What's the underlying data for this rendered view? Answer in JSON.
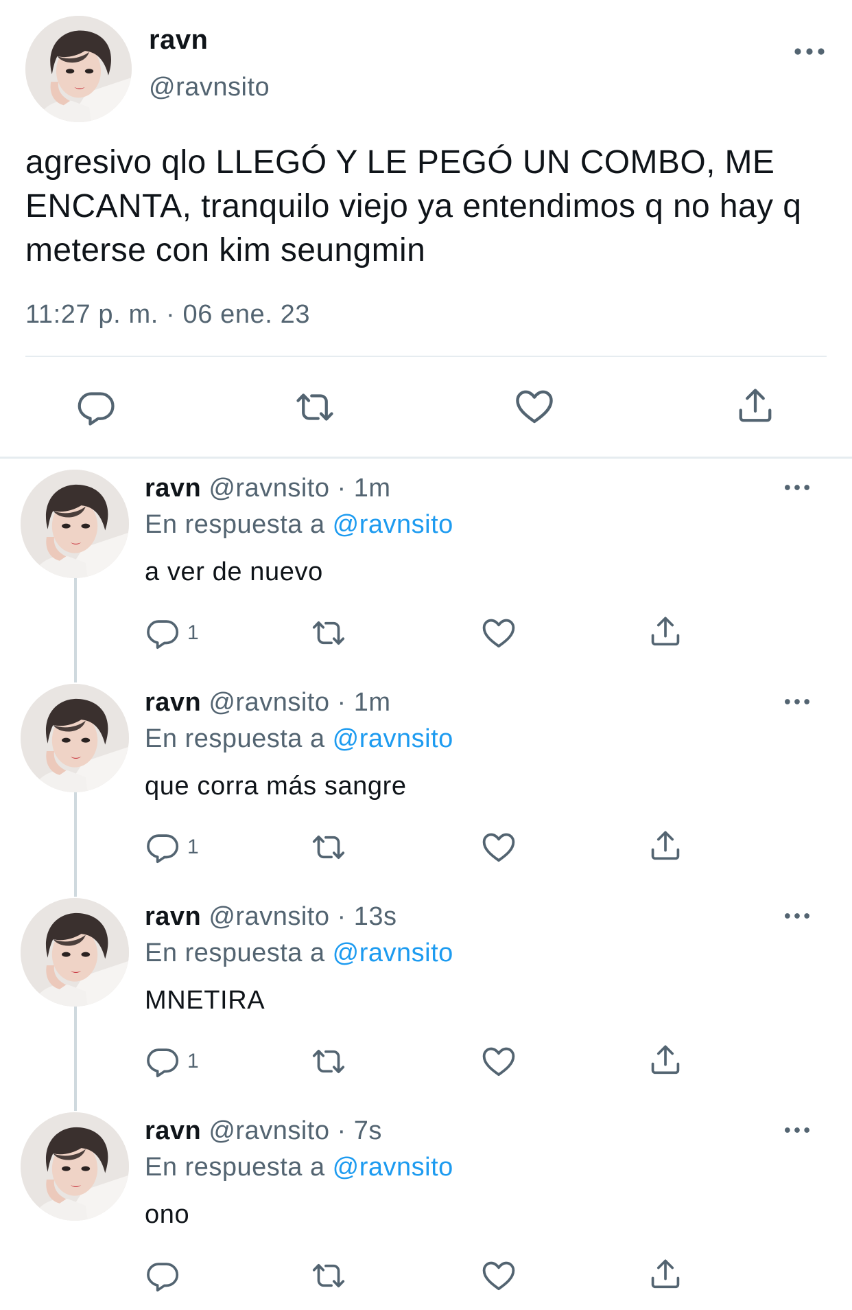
{
  "main_tweet": {
    "display_name": "ravn",
    "handle": "@ravnsito",
    "text": "agresivo qlo LLEGÓ Y LE PEGÓ UN COMBO, ME ENCANTA, tranquilo viejo ya entendimos q no hay q meterse con kim seungmin",
    "timestamp": "11:27 p. m. · 06 ene. 23",
    "actions": [
      "reply-icon",
      "retweet-icon",
      "like-icon",
      "share-icon"
    ]
  },
  "replies": [
    {
      "display_name": "ravn",
      "handle": "@ravnsito",
      "separator": "·",
      "time": "1m",
      "reply_prefix": "En respuesta a",
      "reply_mention": "@ravnsito",
      "text": "a ver de nuevo",
      "reply_count": "1"
    },
    {
      "display_name": "ravn",
      "handle": "@ravnsito",
      "separator": "·",
      "time": "1m",
      "reply_prefix": "En respuesta a",
      "reply_mention": "@ravnsito",
      "text": "que corra más sangre",
      "reply_count": "1"
    },
    {
      "display_name": "ravn",
      "handle": "@ravnsito",
      "separator": "·",
      "time": "13s",
      "reply_prefix": "En respuesta a",
      "reply_mention": "@ravnsito",
      "text": "MNETIRA",
      "reply_count": "1"
    },
    {
      "display_name": "ravn",
      "handle": "@ravnsito",
      "separator": "·",
      "time": "7s",
      "reply_prefix": "En respuesta a",
      "reply_mention": "@ravnsito",
      "text": "ono",
      "reply_count": ""
    }
  ],
  "colors": {
    "text": "#0f1419",
    "secondary": "#536471",
    "link": "#1d9bf0",
    "divider": "#e6ecf0",
    "thread_line": "#cfd9de"
  }
}
